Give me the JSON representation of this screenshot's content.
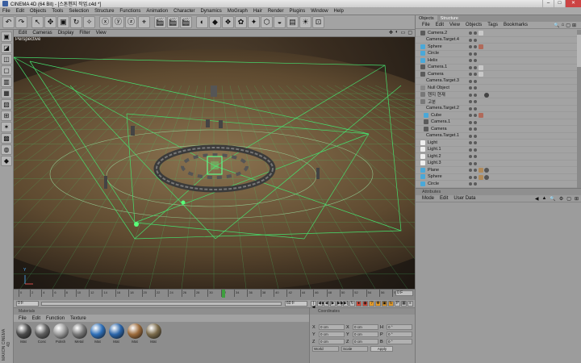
{
  "window": {
    "title": "CINEMA 4D (64 Bit) - [스톤헨지 작업.c4d *]",
    "buttons": [
      "–",
      "□",
      "✕"
    ]
  },
  "menubar": [
    "File",
    "Edit",
    "Objects",
    "Tools",
    "Selection",
    "Structure",
    "Functions",
    "Animation",
    "Character",
    "Dynamics",
    "MoGraph",
    "Hair",
    "Render",
    "Plugins",
    "Window",
    "Help"
  ],
  "viewport": {
    "menu": [
      "Edit",
      "Cameras",
      "Display",
      "Filter",
      "View"
    ],
    "label": "Perspective",
    "nav_icons": [
      "✥",
      "◐",
      "▭",
      "▢"
    ],
    "ground_color": "#6b5637",
    "wire_color": "#54e07a"
  },
  "timeline": {
    "ticks": [
      "0",
      "2",
      "4",
      "6",
      "8",
      "10",
      "12",
      "14",
      "16",
      "18",
      "20",
      "22",
      "24",
      "26",
      "28",
      "30",
      "32",
      "34",
      "36",
      "38",
      "40",
      "42",
      "44",
      "46",
      "48",
      "50",
      "52",
      "54",
      "56",
      "58"
    ],
    "end_frame": "0 F",
    "current_frame": "0 F",
    "max_frame": "60 F"
  },
  "materials": {
    "header": "Materials",
    "menu": [
      "File",
      "Edit",
      "Function",
      "Texture"
    ],
    "items": [
      {
        "label": "Mat",
        "color": "#4a4a4a"
      },
      {
        "label": "Conc",
        "color": "#5e5e5e"
      },
      {
        "label": "Polish",
        "color": "#9a9a9a"
      },
      {
        "label": "Metal",
        "color": "#777777"
      },
      {
        "label": "Mat",
        "color": "#2e6fb8"
      },
      {
        "label": "Mat",
        "color": "#2a64a8"
      },
      {
        "label": "Mat",
        "color": "#9b6a3a"
      },
      {
        "label": "Mat",
        "color": "#7a6a4a"
      }
    ],
    "side_label": "MAXON CINEMA 4D"
  },
  "coordinates": {
    "header": "Coordinates",
    "rows": [
      {
        "a": "X",
        "v1": "0 cm",
        "b": "X",
        "v2": "0 cm",
        "c": "H",
        "v3": "0 °"
      },
      {
        "a": "Y",
        "v1": "0 cm",
        "b": "Y",
        "v2": "0 cm",
        "c": "P",
        "v3": "0 °"
      },
      {
        "a": "Z",
        "v1": "0 cm",
        "b": "Z",
        "v2": "0 cm",
        "c": "B",
        "v3": "0 °"
      }
    ],
    "mode": "World",
    "size_mode": "Scale",
    "apply": "Apply"
  },
  "object_manager": {
    "tabs": [
      "Objects",
      "Structure"
    ],
    "menu": [
      "File",
      "Edit",
      "View",
      "Objects",
      "Tags",
      "Bookmarks"
    ],
    "rows": [
      {
        "name": "Camera.2",
        "indent": 4,
        "icon": "#5b5b5b",
        "tag": "#c8c8c8",
        "tag2": ""
      },
      {
        "name": "Camera.Target.4",
        "indent": 8,
        "icon": "",
        "tag": "",
        "tag2": ""
      },
      {
        "name": "Sphere",
        "indent": 4,
        "icon": "#4aa8d8",
        "tag": "#b06a5a",
        "tag2": ""
      },
      {
        "name": "Circle",
        "indent": 4,
        "icon": "#4aa8d8",
        "tag": "",
        "tag2": ""
      },
      {
        "name": "Helix",
        "indent": 4,
        "icon": "#4aa8d8",
        "tag": "",
        "tag2": ""
      },
      {
        "name": "Camera.1",
        "indent": 4,
        "icon": "#5b5b5b",
        "tag": "#c8c8c8",
        "tag2": ""
      },
      {
        "name": "Camera",
        "indent": 4,
        "icon": "#5b5b5b",
        "tag": "#c8c8c8",
        "tag2": ""
      },
      {
        "name": "Camera.Target.3",
        "indent": 8,
        "icon": "",
        "tag": "",
        "tag2": ""
      },
      {
        "name": "Null Object",
        "indent": 4,
        "icon": "#888888",
        "tag": "",
        "tag2": ""
      },
      {
        "name": "헨지 현재",
        "indent": 4,
        "icon": "#777777",
        "tag": "",
        "tag2": "#444444"
      },
      {
        "name": "고분",
        "indent": 4,
        "icon": "#777777",
        "tag": "",
        "tag2": ""
      },
      {
        "name": "Camera.Target.2",
        "indent": 8,
        "icon": "",
        "tag": "",
        "tag2": ""
      },
      {
        "name": "Cube",
        "indent": 8,
        "icon": "#4aa8d8",
        "tag": "#b06a5a",
        "tag2": ""
      },
      {
        "name": "Camera.1",
        "indent": 8,
        "icon": "#5b5b5b",
        "tag": "",
        "tag2": ""
      },
      {
        "name": "Camera",
        "indent": 8,
        "icon": "#5b5b5b",
        "tag": "",
        "tag2": ""
      },
      {
        "name": "Camera.Target.1",
        "indent": 8,
        "icon": "",
        "tag": "",
        "tag2": ""
      },
      {
        "name": "Light",
        "indent": 4,
        "icon": "#eeeeee",
        "tag": "",
        "tag2": ""
      },
      {
        "name": "Light.1",
        "indent": 4,
        "icon": "#eeeeee",
        "tag": "",
        "tag2": ""
      },
      {
        "name": "Light.2",
        "indent": 4,
        "icon": "#eeeeee",
        "tag": "",
        "tag2": ""
      },
      {
        "name": "Light.3",
        "indent": 4,
        "icon": "#eeeeee",
        "tag": "",
        "tag2": ""
      },
      {
        "name": "Plane",
        "indent": 4,
        "icon": "#4aa8d8",
        "tag": "#b08a5a",
        "tag2": "#555555"
      },
      {
        "name": "Sphere",
        "indent": 4,
        "icon": "#4aa8d8",
        "tag": "#b08a5a",
        "tag2": "#555555"
      },
      {
        "name": "Circle",
        "indent": 4,
        "icon": "#4aa8d8",
        "tag": "",
        "tag2": ""
      }
    ]
  },
  "attributes": {
    "header": "Attributes",
    "menu": [
      "Mode",
      "Edit",
      "User Data"
    ],
    "nav": [
      "◀",
      "▲",
      "🔍",
      "⚙",
      "▢",
      "⊞"
    ]
  },
  "toolbar_icons": [
    "↶",
    "↷",
    "↖",
    "✥",
    "▣",
    "↻",
    "✧",
    "ⓧ",
    "ⓨ",
    "ⓩ",
    "⌖",
    "🎬",
    "🎬",
    "🎬",
    "◐",
    "◆",
    "❖",
    "✿",
    "✦",
    "⬡",
    "◒",
    "▤",
    "☀",
    "⊡"
  ],
  "left_icons": [
    "▣",
    "◪",
    "◫",
    "▢",
    "▥",
    "▦",
    "▧",
    "⊞",
    "✶",
    "▩",
    "◍",
    "◆"
  ]
}
